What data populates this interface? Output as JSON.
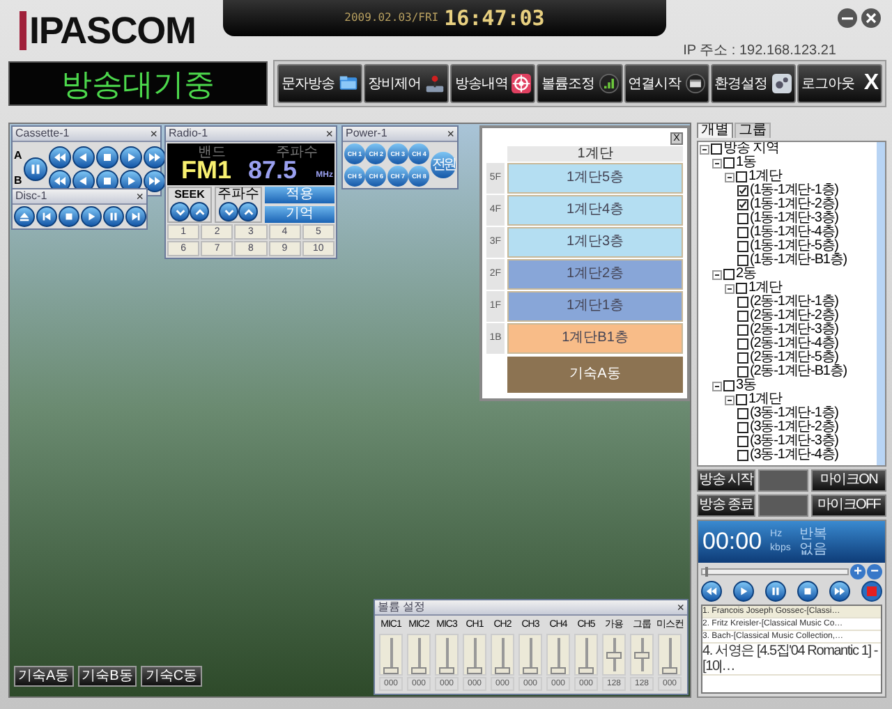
{
  "app": {
    "logo": "IPASCOM",
    "status": "방송대기중",
    "date": "2009.02.03/FRI",
    "clock": "16:47:03",
    "ip": "IP 주소 : 192.168.123.21"
  },
  "window_controls": [
    {
      "kind": "minimize"
    },
    {
      "kind": "close"
    }
  ],
  "toolbar": [
    {
      "label": "문자방송",
      "kind": "folder"
    },
    {
      "label": "장비제어",
      "kind": "joystick"
    },
    {
      "label": "방송내역",
      "kind": "target"
    },
    {
      "label": "볼륨조정",
      "kind": "signal"
    },
    {
      "label": "연결시작",
      "kind": "window"
    },
    {
      "label": "환경설정",
      "kind": "gear"
    },
    {
      "label": "로그아웃",
      "kind": "glyph",
      "glyph": "X"
    }
  ],
  "cassette": {
    "title": "Cassette-1",
    "close": "×",
    "main": {
      "kind": "pause"
    },
    "rows": [
      {
        "label": "A",
        "buttons": [
          {
            "kind": "rew"
          },
          {
            "kind": "back"
          },
          {
            "kind": "stop"
          },
          {
            "kind": "play"
          },
          {
            "kind": "ff"
          }
        ]
      },
      {
        "label": "B",
        "buttons": [
          {
            "kind": "rew"
          },
          {
            "kind": "back"
          },
          {
            "kind": "stop"
          },
          {
            "kind": "play"
          },
          {
            "kind": "ff"
          }
        ]
      }
    ]
  },
  "disc": {
    "title": "Disc-1",
    "close": "×",
    "buttons": [
      {
        "kind": "eject"
      },
      {
        "kind": "prev"
      },
      {
        "kind": "stop"
      },
      {
        "kind": "play"
      },
      {
        "kind": "pause"
      },
      {
        "kind": "next"
      }
    ]
  },
  "radio": {
    "title": "Radio-1",
    "close": "×",
    "band_label": "밴드",
    "freq_label": "주파수",
    "band": "FM1",
    "freq": "87.5",
    "unit": "MHz",
    "seek": "SEEK",
    "tune": "주파수",
    "apply": "적용",
    "store": "기억",
    "presets": [
      "1",
      "2",
      "3",
      "4",
      "5",
      "6",
      "7",
      "8",
      "9",
      "10"
    ]
  },
  "power": {
    "title": "Power-1",
    "close": "×",
    "channels": [
      "CH 1",
      "CH 2",
      "CH 3",
      "CH 4",
      "CH 5",
      "CH 6",
      "CH 7",
      "CH 8"
    ],
    "main": "전원"
  },
  "floor_panel": {
    "close": "X",
    "building": "1계단",
    "floors": [
      {
        "label": "5F",
        "name": "1계단5층",
        "color": "#b4def2"
      },
      {
        "label": "4F",
        "name": "1계단4층",
        "color": "#b4def2"
      },
      {
        "label": "3F",
        "name": "1계단3층",
        "color": "#b4def2"
      },
      {
        "label": "2F",
        "name": "1계단2층",
        "color": "#88a6d8"
      },
      {
        "label": "1F",
        "name": "1계단1층",
        "color": "#88a6d8"
      },
      {
        "label": "1B",
        "name": "1계단B1층",
        "color": "#f8bc88"
      }
    ],
    "annex": {
      "name": "기숙A동",
      "color": "#8c7352"
    }
  },
  "buildings": [
    "기숙A동",
    "기숙B동",
    "기숙C동"
  ],
  "volume": {
    "title": "볼륨 설정",
    "close": "×",
    "channels": [
      {
        "name": "MIC1",
        "level": 0,
        "reading": "000"
      },
      {
        "name": "MIC2",
        "level": 0,
        "reading": "000"
      },
      {
        "name": "MIC3",
        "level": 0,
        "reading": "000"
      },
      {
        "name": "CH1",
        "level": 0,
        "reading": "000"
      },
      {
        "name": "CH2",
        "level": 0,
        "reading": "000"
      },
      {
        "name": "CH3",
        "level": 0,
        "reading": "000"
      },
      {
        "name": "CH4",
        "level": 0,
        "reading": "000"
      },
      {
        "name": "CH5",
        "level": 0,
        "reading": "000"
      },
      {
        "name": "가용",
        "level": 0.5,
        "reading": "128"
      },
      {
        "name": "그룹",
        "level": 0.5,
        "reading": "128"
      },
      {
        "name": "미스컨",
        "level": 0,
        "reading": "000"
      }
    ]
  },
  "side": {
    "tabs": [
      {
        "label": "개별",
        "selected": true
      },
      {
        "label": "그룹",
        "selected": false
      }
    ],
    "tree": [
      {
        "label": "방송 지역",
        "checked": false,
        "expanded": true,
        "children": [
          {
            "label": "1동",
            "checked": false,
            "expanded": true,
            "children": [
              {
                "label": "1계단",
                "checked": false,
                "expanded": true,
                "children": [
                  {
                    "label": "(1동-1계단-1층)",
                    "checked": true
                  },
                  {
                    "label": "(1동-1계단-2층)",
                    "checked": true
                  },
                  {
                    "label": "(1동-1계단-3층)",
                    "checked": false
                  },
                  {
                    "label": "(1동-1계단-4층)",
                    "checked": false
                  },
                  {
                    "label": "(1동-1계단-5층)",
                    "checked": false
                  },
                  {
                    "label": "(1동-1계단-B1층)",
                    "checked": false
                  }
                ]
              }
            ]
          },
          {
            "label": "2동",
            "checked": false,
            "expanded": true,
            "children": [
              {
                "label": "1계단",
                "checked": false,
                "expanded": true,
                "children": [
                  {
                    "label": "(2동-1계단-1층)",
                    "checked": false
                  },
                  {
                    "label": "(2동-1계단-2층)",
                    "checked": false
                  },
                  {
                    "label": "(2동-1계단-3층)",
                    "checked": false
                  },
                  {
                    "label": "(2동-1계단-4층)",
                    "checked": false
                  },
                  {
                    "label": "(2동-1계단-5층)",
                    "checked": false
                  },
                  {
                    "label": "(2동-1계단-B1층)",
                    "checked": false
                  }
                ]
              }
            ]
          },
          {
            "label": "3동",
            "checked": false,
            "expanded": true,
            "children": [
              {
                "label": "1계단",
                "checked": false,
                "expanded": true,
                "children": [
                  {
                    "label": "(3동-1계단-1층)",
                    "checked": false
                  },
                  {
                    "label": "(3동-1계단-2층)",
                    "checked": false
                  },
                  {
                    "label": "(3동-1계단-3층)",
                    "checked": false
                  },
                  {
                    "label": "(3동-1계단-4층)",
                    "checked": false
                  }
                ]
              }
            ]
          }
        ]
      }
    ],
    "buttons": [
      {
        "label": "방송 시작",
        "disabled": false
      },
      {
        "disabled": true
      },
      {
        "label": "마이크ON",
        "disabled": false
      },
      {
        "label": "방송 종료",
        "disabled": false
      },
      {
        "disabled": true
      },
      {
        "label": "마이크OFF",
        "disabled": false
      }
    ]
  },
  "player": {
    "time": "00:00",
    "hz": "Hz",
    "kbps": "kbps",
    "repeat": "반복",
    "repeat_value": "없음",
    "level": 0.02,
    "plus": "+",
    "minus": "−",
    "controls": [
      {
        "kind": "rew"
      },
      {
        "kind": "play"
      },
      {
        "kind": "pause"
      },
      {
        "kind": "stop"
      },
      {
        "kind": "ff"
      },
      {
        "kind": "rec"
      }
    ],
    "playlist": [
      {
        "text": "1. Francois Joseph Gossec-[Classi…",
        "selected": true
      },
      {
        "text": "2. Fritz Kreisler-[Classical Music Co…",
        "selected": false
      },
      {
        "text": "3. Bach-[Classical Music Collection,…",
        "selected": false
      },
      {
        "text": "4. 서영은 [4.5집'04 Romantic 1] - [10|…",
        "selected": false
      }
    ]
  }
}
